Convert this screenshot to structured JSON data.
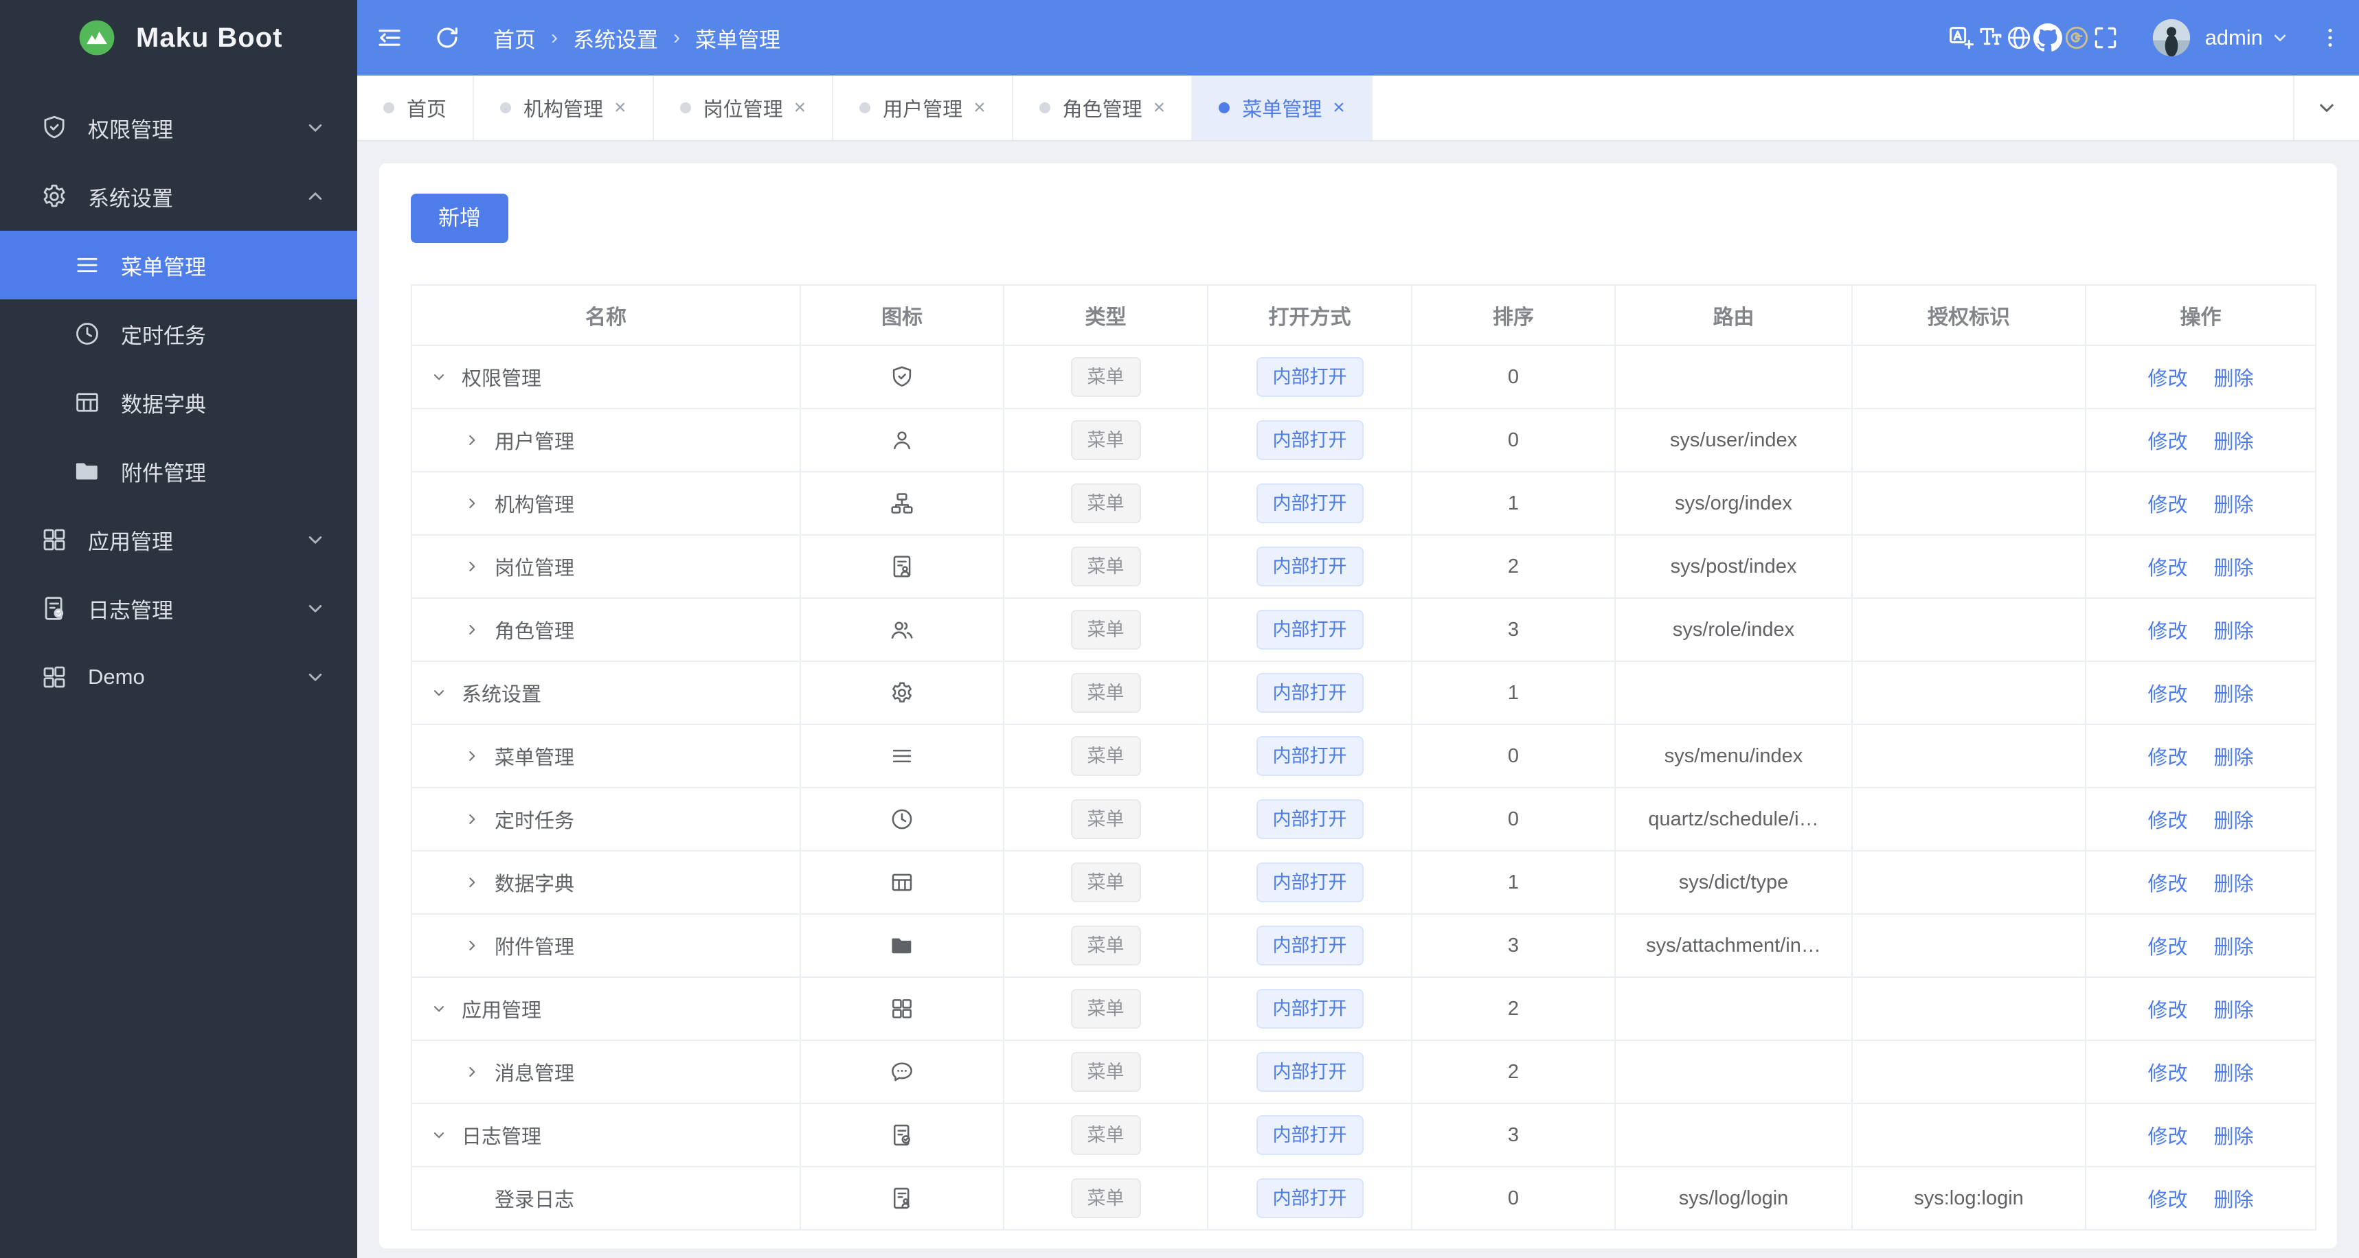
{
  "app": {
    "name": "Maku Boot"
  },
  "theme": {
    "primary": "#4e7ce8",
    "header_bg": "#5786ea",
    "sidebar_bg": "#2b333e",
    "page_bg": "#eef0f4",
    "logo_green": "#53b958",
    "tag_info_bg": "#f4f4f5",
    "tag_info_text": "#909399",
    "tag_info_border": "#e9e9eb",
    "tag_primary_bg": "#ecf2fd",
    "tag_primary_text": "#4e7ce8",
    "tag_primary_border": "#d9e5fb"
  },
  "ui": {
    "close_glyph": "×",
    "breadcrumb_sep": "›"
  },
  "header": {
    "breadcrumb": [
      "首页",
      "系统设置",
      "菜单管理"
    ],
    "left_icons": [
      "collapse",
      "refresh"
    ],
    "right_icons": [
      "translate",
      "font-size",
      "globe",
      "github",
      "gitee",
      "fullscreen"
    ],
    "user": "admin"
  },
  "sidebar": {
    "items": [
      {
        "id": "permission",
        "label": "权限管理",
        "icon": "shield-check",
        "chevron": "down"
      },
      {
        "id": "system",
        "label": "系统设置",
        "icon": "gear",
        "chevron": "up",
        "children": [
          {
            "id": "menu",
            "label": "菜单管理",
            "icon": "menu-lines",
            "active": true
          },
          {
            "id": "schedule",
            "label": "定时任务",
            "icon": "clock"
          },
          {
            "id": "dict",
            "label": "数据字典",
            "icon": "dict-table"
          },
          {
            "id": "attachment",
            "label": "附件管理",
            "icon": "folder"
          }
        ]
      },
      {
        "id": "app",
        "label": "应用管理",
        "icon": "grid",
        "chevron": "down"
      },
      {
        "id": "log",
        "label": "日志管理",
        "icon": "log-doc",
        "chevron": "down"
      },
      {
        "id": "demo",
        "label": "Demo",
        "icon": "grid-demo",
        "chevron": "down"
      }
    ]
  },
  "tabs": [
    {
      "label": "首页",
      "closable": false,
      "active": false
    },
    {
      "label": "机构管理",
      "closable": true,
      "active": false
    },
    {
      "label": "岗位管理",
      "closable": true,
      "active": false
    },
    {
      "label": "用户管理",
      "closable": true,
      "active": false
    },
    {
      "label": "角色管理",
      "closable": true,
      "active": false
    },
    {
      "label": "菜单管理",
      "closable": true,
      "active": true
    }
  ],
  "toolbar": {
    "add_label": "新增"
  },
  "table": {
    "columns": [
      "名称",
      "图标",
      "类型",
      "打开方式",
      "排序",
      "路由",
      "授权标识",
      "操作"
    ],
    "type_tag": "菜单",
    "open_tag": "内部打开",
    "actions": {
      "edit": "修改",
      "delete": "删除"
    },
    "rows": [
      {
        "name": "权限管理",
        "icon": "shield-check",
        "level": 0,
        "expand": "down",
        "sort": "0",
        "route": "",
        "auth": ""
      },
      {
        "name": "用户管理",
        "icon": "user",
        "level": 1,
        "expand": "right",
        "sort": "0",
        "route": "sys/user/index",
        "auth": ""
      },
      {
        "name": "机构管理",
        "icon": "org",
        "level": 1,
        "expand": "right",
        "sort": "1",
        "route": "sys/org/index",
        "auth": ""
      },
      {
        "name": "岗位管理",
        "icon": "post",
        "level": 1,
        "expand": "right",
        "sort": "2",
        "route": "sys/post/index",
        "auth": ""
      },
      {
        "name": "角色管理",
        "icon": "users",
        "level": 1,
        "expand": "right",
        "sort": "3",
        "route": "sys/role/index",
        "auth": ""
      },
      {
        "name": "系统设置",
        "icon": "gear",
        "level": 0,
        "expand": "down",
        "sort": "1",
        "route": "",
        "auth": ""
      },
      {
        "name": "菜单管理",
        "icon": "menu-lines",
        "level": 1,
        "expand": "right",
        "sort": "0",
        "route": "sys/menu/index",
        "auth": ""
      },
      {
        "name": "定时任务",
        "icon": "clock",
        "level": 1,
        "expand": "right",
        "sort": "0",
        "route": "quartz/schedule/i…",
        "auth": ""
      },
      {
        "name": "数据字典",
        "icon": "dict-table",
        "level": 1,
        "expand": "right",
        "sort": "1",
        "route": "sys/dict/type",
        "auth": ""
      },
      {
        "name": "附件管理",
        "icon": "folder",
        "level": 1,
        "expand": "right",
        "sort": "3",
        "route": "sys/attachment/in…",
        "auth": ""
      },
      {
        "name": "应用管理",
        "icon": "grid",
        "level": 0,
        "expand": "down",
        "sort": "2",
        "route": "",
        "auth": ""
      },
      {
        "name": "消息管理",
        "icon": "chat",
        "level": 1,
        "expand": "right",
        "sort": "2",
        "route": "",
        "auth": ""
      },
      {
        "name": "日志管理",
        "icon": "log-doc",
        "level": 0,
        "expand": "down",
        "sort": "3",
        "route": "",
        "auth": ""
      },
      {
        "name": "登录日志",
        "icon": "login-log",
        "level": 1,
        "expand": "none",
        "sort": "0",
        "route": "sys/log/login",
        "auth": "sys:log:login"
      }
    ]
  }
}
